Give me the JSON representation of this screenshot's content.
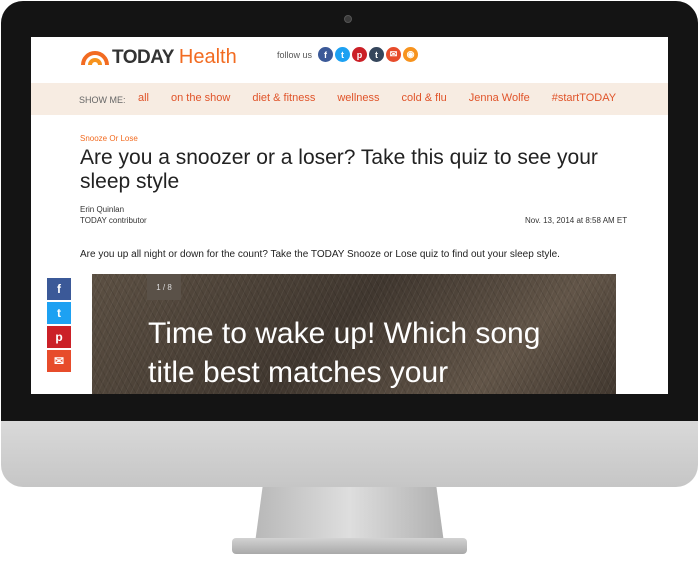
{
  "brand": {
    "name_bold": "TODAY",
    "name_light": "Health"
  },
  "follow_label": "follow us",
  "social_icons": [
    {
      "icon": "facebook-icon",
      "glyph": "f",
      "color": "#3b5998"
    },
    {
      "icon": "twitter-icon",
      "glyph": "t",
      "color": "#1da1f2"
    },
    {
      "icon": "pinterest-icon",
      "glyph": "p",
      "color": "#cb2027"
    },
    {
      "icon": "tumblr-icon",
      "glyph": "t",
      "color": "#35465c"
    },
    {
      "icon": "email-icon",
      "glyph": "✉",
      "color": "#e74c2b"
    },
    {
      "icon": "rss-icon",
      "glyph": "◉",
      "color": "#f7931e"
    }
  ],
  "nav": {
    "show_me": "SHOW ME:",
    "items": [
      "all",
      "on the show",
      "diet & fitness",
      "wellness",
      "cold & flu",
      "Jenna Wolfe",
      "#startTODAY"
    ]
  },
  "article": {
    "kicker": "Snooze Or Lose",
    "headline": "Are you a snoozer or a loser? Take this quiz to see your sleep style",
    "author": "Erin Quinlan",
    "author_role": "TODAY contributor",
    "date": "Nov. 13, 2014 at 8:58 AM ET",
    "lede": "Are you up all night or down for the count? Take the TODAY Snooze or Lose quiz to find out your sleep style."
  },
  "share_buttons": [
    {
      "icon": "facebook-icon",
      "glyph": "f",
      "color": "#3b5998"
    },
    {
      "icon": "twitter-icon",
      "glyph": "t",
      "color": "#1da1f2"
    },
    {
      "icon": "pinterest-icon",
      "glyph": "p",
      "color": "#cb2027"
    },
    {
      "icon": "email-icon",
      "glyph": "✉",
      "color": "#e74c2b"
    }
  ],
  "quiz": {
    "counter": "1 / 8",
    "question": "Time to wake up! Which song title best matches your"
  },
  "colors": {
    "accent": "#f26b21",
    "nav_link": "#e0542a",
    "nav_bg": "#f7ece2",
    "bezel": "#141414"
  }
}
